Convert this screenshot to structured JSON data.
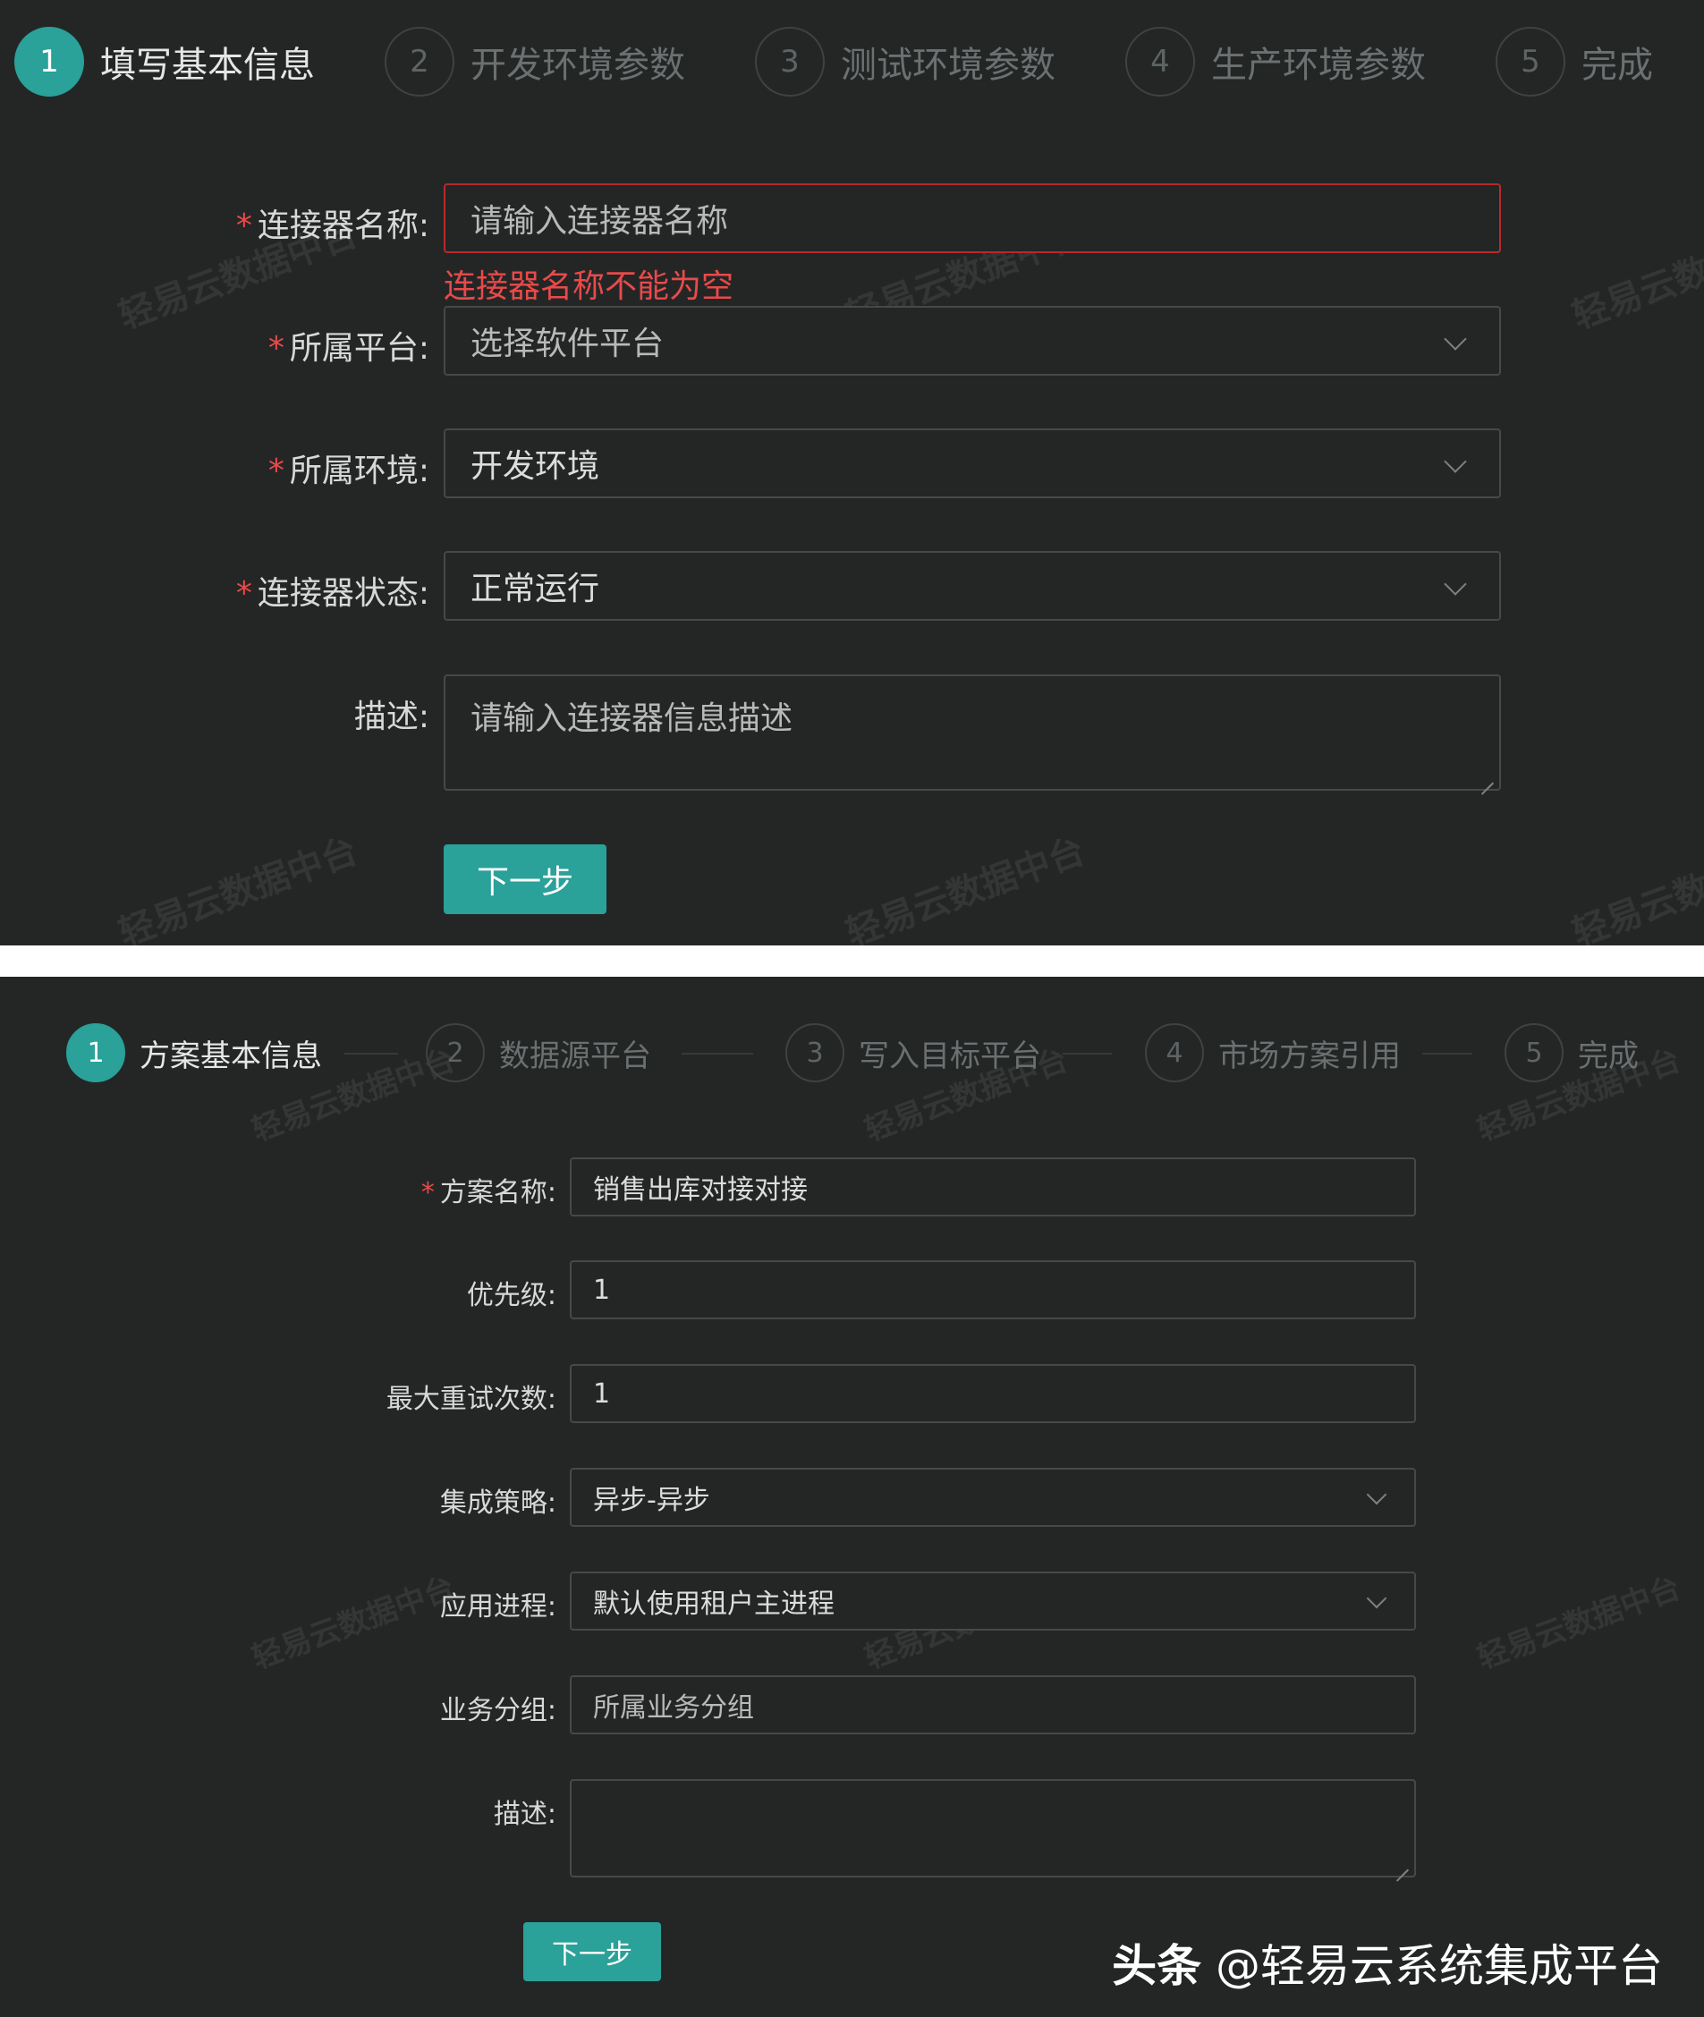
{
  "panel_a": {
    "steps": [
      {
        "num": "1",
        "label": "填写基本信息",
        "active": true
      },
      {
        "num": "2",
        "label": "开发环境参数"
      },
      {
        "num": "3",
        "label": "测试环境参数"
      },
      {
        "num": "4",
        "label": "生产环境参数"
      },
      {
        "num": "5",
        "label": "完成"
      }
    ],
    "required_mark": "*",
    "fields": {
      "connector_name": {
        "label": "连接器名称:",
        "placeholder": "请输入连接器名称",
        "error": "连接器名称不能为空"
      },
      "platform": {
        "label": "所属平台:",
        "placeholder": "选择软件平台"
      },
      "environment": {
        "label": "所属环境:",
        "value": "开发环境"
      },
      "status": {
        "label": "连接器状态:",
        "value": "正常运行"
      },
      "description": {
        "label": "描述:",
        "placeholder": "请输入连接器信息描述"
      }
    },
    "next_button": "下一步",
    "watermark": "轻易云数据中台"
  },
  "panel_b": {
    "steps": [
      {
        "num": "1",
        "label": "方案基本信息",
        "active": true
      },
      {
        "num": "2",
        "label": "数据源平台"
      },
      {
        "num": "3",
        "label": "写入目标平台"
      },
      {
        "num": "4",
        "label": "市场方案引用"
      },
      {
        "num": "5",
        "label": "完成"
      }
    ],
    "required_mark": "*",
    "fields": {
      "plan_name": {
        "label": "方案名称:",
        "value": "销售出库对接对接"
      },
      "priority": {
        "label": "优先级:",
        "value": "1"
      },
      "max_retry": {
        "label": "最大重试次数:",
        "value": "1"
      },
      "strategy": {
        "label": "集成策略:",
        "value": "异步-异步"
      },
      "process": {
        "label": "应用进程:",
        "value": "默认使用租户主进程"
      },
      "group": {
        "label": "业务分组:",
        "placeholder": "所属业务分组"
      },
      "description": {
        "label": "描述:"
      }
    },
    "next_button": "下一步",
    "watermark": "轻易云数据中台"
  },
  "footer": {
    "brand": "头条",
    "account": "@轻易云系统集成平台"
  },
  "colors": {
    "background": "#242626",
    "accent": "#2aa199",
    "error": "#e84a4a",
    "border": "#454949"
  }
}
